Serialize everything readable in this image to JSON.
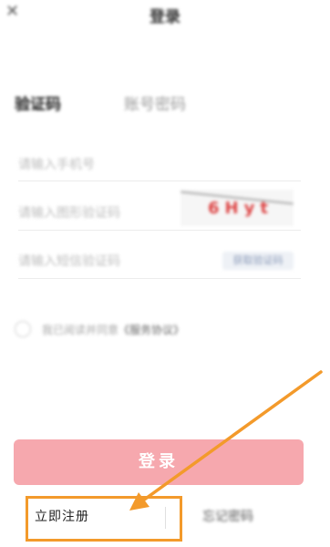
{
  "header": {
    "close_icon": "close-icon",
    "title": "登录"
  },
  "tabs": [
    {
      "label": "验证码"
    },
    {
      "label": "账号密码"
    }
  ],
  "form": {
    "phone_placeholder": "请输入手机号",
    "captcha_placeholder": "请输入图形验证码",
    "captcha_text": "6Hyt",
    "sms_placeholder": "请输入短信验证码",
    "sms_button": "获取验证码"
  },
  "agreement": {
    "text": "我已阅读并同意",
    "link": "《服务协议》"
  },
  "login_button": "登录",
  "bottom": {
    "register": "立即注册",
    "forgot": "忘记密码"
  },
  "colors": {
    "accent": "#f6a8ae",
    "highlight": "#f39a2b"
  }
}
